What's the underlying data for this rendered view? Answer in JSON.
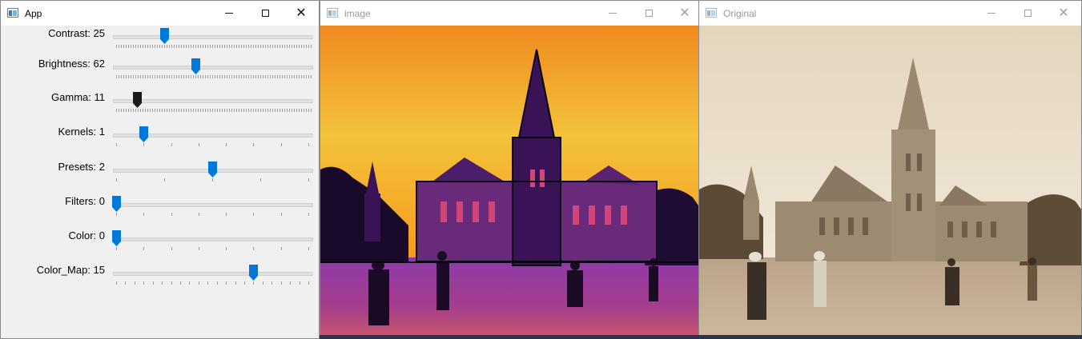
{
  "windows": {
    "app": {
      "title": "App",
      "active": true
    },
    "image": {
      "title": "image",
      "active": false
    },
    "original": {
      "title": "Original",
      "active": false
    }
  },
  "controls": {
    "minimize": "minimize-icon",
    "maximize": "maximize-icon",
    "close": "close-icon"
  },
  "trackbars": [
    {
      "id": "contrast",
      "label": "Contrast: 25",
      "value": 25,
      "max": 100,
      "ticks": "dense",
      "focused": false
    },
    {
      "id": "brightness",
      "label": "Brightness: 62",
      "value": 62,
      "max": 150,
      "ticks": "dense",
      "focused": false
    },
    {
      "id": "gamma",
      "label": "Gamma: 11",
      "value": 11,
      "max": 100,
      "ticks": "dense",
      "focused": true
    },
    {
      "id": "kernels",
      "label": "Kernels: 1",
      "value": 1,
      "max": 7,
      "ticks": "sparse",
      "focused": false
    },
    {
      "id": "presets",
      "label": "Presets: 2",
      "value": 2,
      "max": 4,
      "ticks": "sparse",
      "focused": false
    },
    {
      "id": "filters",
      "label": "Filters: 0",
      "value": 0,
      "max": 7,
      "ticks": "sparse",
      "focused": false
    },
    {
      "id": "color",
      "label": "Color: 0",
      "value": 0,
      "max": 7,
      "ticks": "sparse",
      "focused": false
    },
    {
      "id": "color_map",
      "label": "Color_Map: 15",
      "value": 15,
      "max": 21,
      "ticks": "sparse",
      "focused": false
    }
  ],
  "colors": {
    "thumb": "#0078d7",
    "thumb_focused": "#1a1a1a",
    "track": "#e0e0e0",
    "inactive_title": "#9a9a9a"
  }
}
